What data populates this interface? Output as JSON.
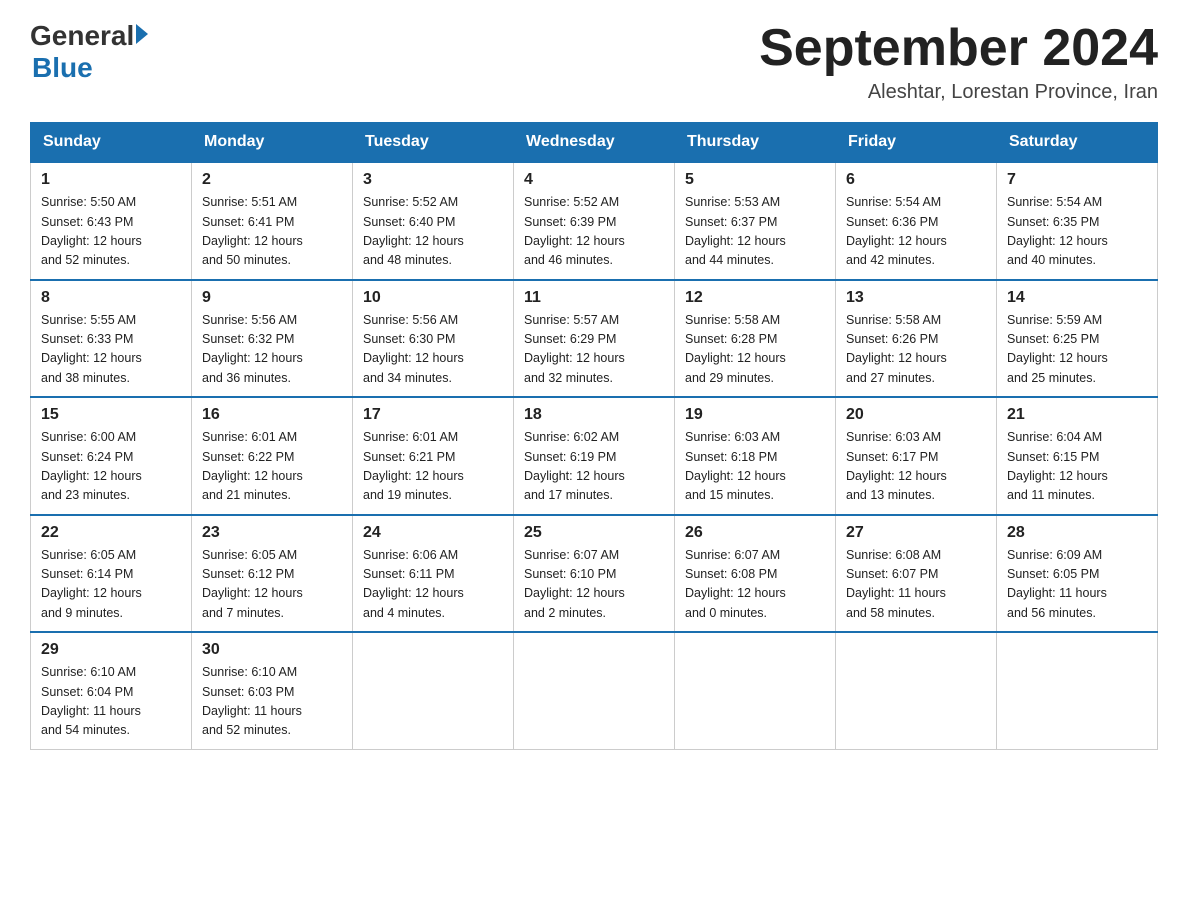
{
  "header": {
    "logo_general": "General",
    "logo_blue": "Blue",
    "month_title": "September 2024",
    "location": "Aleshtar, Lorestan Province, Iran"
  },
  "days_of_week": [
    "Sunday",
    "Monday",
    "Tuesday",
    "Wednesday",
    "Thursday",
    "Friday",
    "Saturday"
  ],
  "weeks": [
    [
      {
        "num": "1",
        "sunrise": "5:50 AM",
        "sunset": "6:43 PM",
        "daylight": "12 hours and 52 minutes."
      },
      {
        "num": "2",
        "sunrise": "5:51 AM",
        "sunset": "6:41 PM",
        "daylight": "12 hours and 50 minutes."
      },
      {
        "num": "3",
        "sunrise": "5:52 AM",
        "sunset": "6:40 PM",
        "daylight": "12 hours and 48 minutes."
      },
      {
        "num": "4",
        "sunrise": "5:52 AM",
        "sunset": "6:39 PM",
        "daylight": "12 hours and 46 minutes."
      },
      {
        "num": "5",
        "sunrise": "5:53 AM",
        "sunset": "6:37 PM",
        "daylight": "12 hours and 44 minutes."
      },
      {
        "num": "6",
        "sunrise": "5:54 AM",
        "sunset": "6:36 PM",
        "daylight": "12 hours and 42 minutes."
      },
      {
        "num": "7",
        "sunrise": "5:54 AM",
        "sunset": "6:35 PM",
        "daylight": "12 hours and 40 minutes."
      }
    ],
    [
      {
        "num": "8",
        "sunrise": "5:55 AM",
        "sunset": "6:33 PM",
        "daylight": "12 hours and 38 minutes."
      },
      {
        "num": "9",
        "sunrise": "5:56 AM",
        "sunset": "6:32 PM",
        "daylight": "12 hours and 36 minutes."
      },
      {
        "num": "10",
        "sunrise": "5:56 AM",
        "sunset": "6:30 PM",
        "daylight": "12 hours and 34 minutes."
      },
      {
        "num": "11",
        "sunrise": "5:57 AM",
        "sunset": "6:29 PM",
        "daylight": "12 hours and 32 minutes."
      },
      {
        "num": "12",
        "sunrise": "5:58 AM",
        "sunset": "6:28 PM",
        "daylight": "12 hours and 29 minutes."
      },
      {
        "num": "13",
        "sunrise": "5:58 AM",
        "sunset": "6:26 PM",
        "daylight": "12 hours and 27 minutes."
      },
      {
        "num": "14",
        "sunrise": "5:59 AM",
        "sunset": "6:25 PM",
        "daylight": "12 hours and 25 minutes."
      }
    ],
    [
      {
        "num": "15",
        "sunrise": "6:00 AM",
        "sunset": "6:24 PM",
        "daylight": "12 hours and 23 minutes."
      },
      {
        "num": "16",
        "sunrise": "6:01 AM",
        "sunset": "6:22 PM",
        "daylight": "12 hours and 21 minutes."
      },
      {
        "num": "17",
        "sunrise": "6:01 AM",
        "sunset": "6:21 PM",
        "daylight": "12 hours and 19 minutes."
      },
      {
        "num": "18",
        "sunrise": "6:02 AM",
        "sunset": "6:19 PM",
        "daylight": "12 hours and 17 minutes."
      },
      {
        "num": "19",
        "sunrise": "6:03 AM",
        "sunset": "6:18 PM",
        "daylight": "12 hours and 15 minutes."
      },
      {
        "num": "20",
        "sunrise": "6:03 AM",
        "sunset": "6:17 PM",
        "daylight": "12 hours and 13 minutes."
      },
      {
        "num": "21",
        "sunrise": "6:04 AM",
        "sunset": "6:15 PM",
        "daylight": "12 hours and 11 minutes."
      }
    ],
    [
      {
        "num": "22",
        "sunrise": "6:05 AM",
        "sunset": "6:14 PM",
        "daylight": "12 hours and 9 minutes."
      },
      {
        "num": "23",
        "sunrise": "6:05 AM",
        "sunset": "6:12 PM",
        "daylight": "12 hours and 7 minutes."
      },
      {
        "num": "24",
        "sunrise": "6:06 AM",
        "sunset": "6:11 PM",
        "daylight": "12 hours and 4 minutes."
      },
      {
        "num": "25",
        "sunrise": "6:07 AM",
        "sunset": "6:10 PM",
        "daylight": "12 hours and 2 minutes."
      },
      {
        "num": "26",
        "sunrise": "6:07 AM",
        "sunset": "6:08 PM",
        "daylight": "12 hours and 0 minutes."
      },
      {
        "num": "27",
        "sunrise": "6:08 AM",
        "sunset": "6:07 PM",
        "daylight": "11 hours and 58 minutes."
      },
      {
        "num": "28",
        "sunrise": "6:09 AM",
        "sunset": "6:05 PM",
        "daylight": "11 hours and 56 minutes."
      }
    ],
    [
      {
        "num": "29",
        "sunrise": "6:10 AM",
        "sunset": "6:04 PM",
        "daylight": "11 hours and 54 minutes."
      },
      {
        "num": "30",
        "sunrise": "6:10 AM",
        "sunset": "6:03 PM",
        "daylight": "11 hours and 52 minutes."
      },
      null,
      null,
      null,
      null,
      null
    ]
  ],
  "labels": {
    "sunrise": "Sunrise:",
    "sunset": "Sunset:",
    "daylight": "Daylight:"
  }
}
